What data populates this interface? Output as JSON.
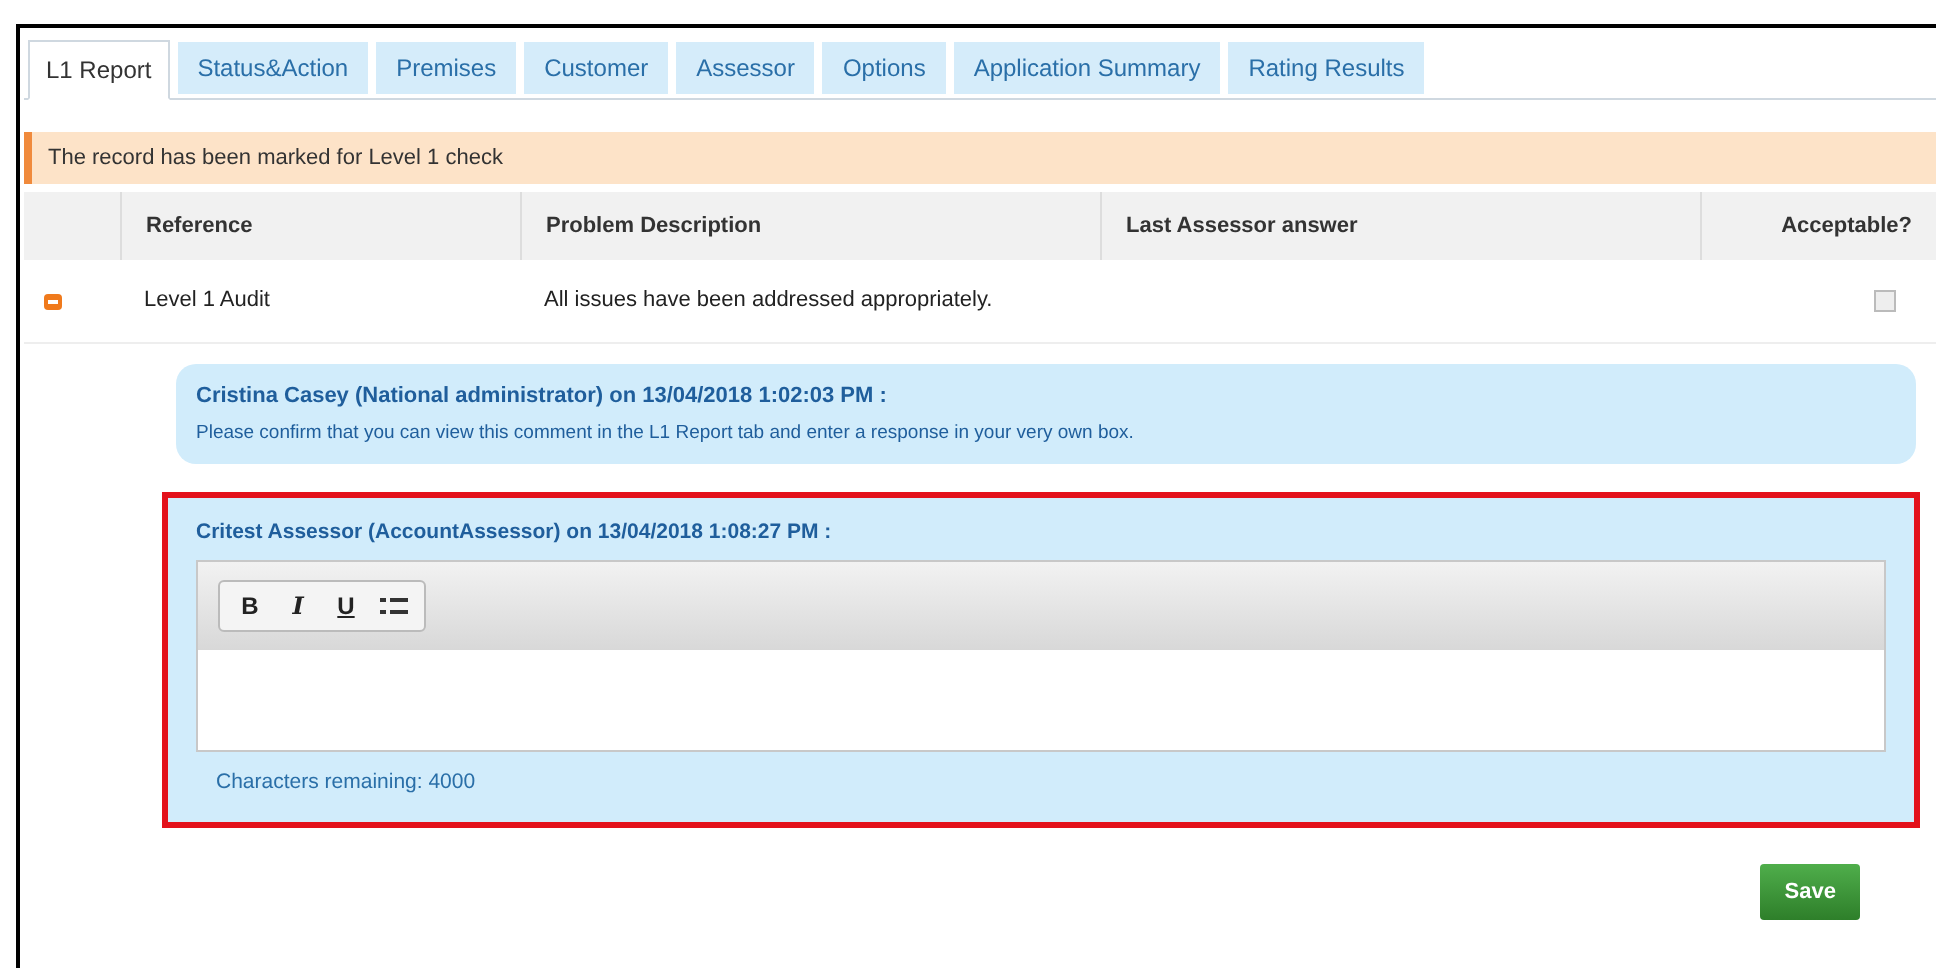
{
  "tabs": [
    {
      "label": "L1 Report",
      "selected": true
    },
    {
      "label": "Status&Action",
      "selected": false
    },
    {
      "label": "Premises",
      "selected": false
    },
    {
      "label": "Customer",
      "selected": false
    },
    {
      "label": "Assessor",
      "selected": false
    },
    {
      "label": "Options",
      "selected": false
    },
    {
      "label": "Application Summary",
      "selected": false
    },
    {
      "label": "Rating Results",
      "selected": false
    }
  ],
  "banner": "The record has been marked for Level 1 check",
  "table": {
    "columns": [
      "Reference",
      "Problem Description",
      "Last Assessor answer",
      "Acceptable?"
    ],
    "rows": [
      {
        "expanded": true,
        "reference": "Level 1 Audit",
        "problem_description": "All issues have been addressed appropriately.",
        "acceptable": false
      }
    ]
  },
  "comment": {
    "author": "Cristina Casey (National administrator) on 13/04/2018 1:02:03 PM :",
    "text": "Please confirm that you can view this comment in the L1 Report tab and enter a response in your very own box."
  },
  "reply": {
    "author": "Critest Assessor (AccountAssessor) on 13/04/2018 1:08:27 PM :",
    "toolbar": [
      "B",
      "I",
      "U"
    ],
    "characters_remaining": "Characters remaining: 4000"
  },
  "save_button": "Save"
}
